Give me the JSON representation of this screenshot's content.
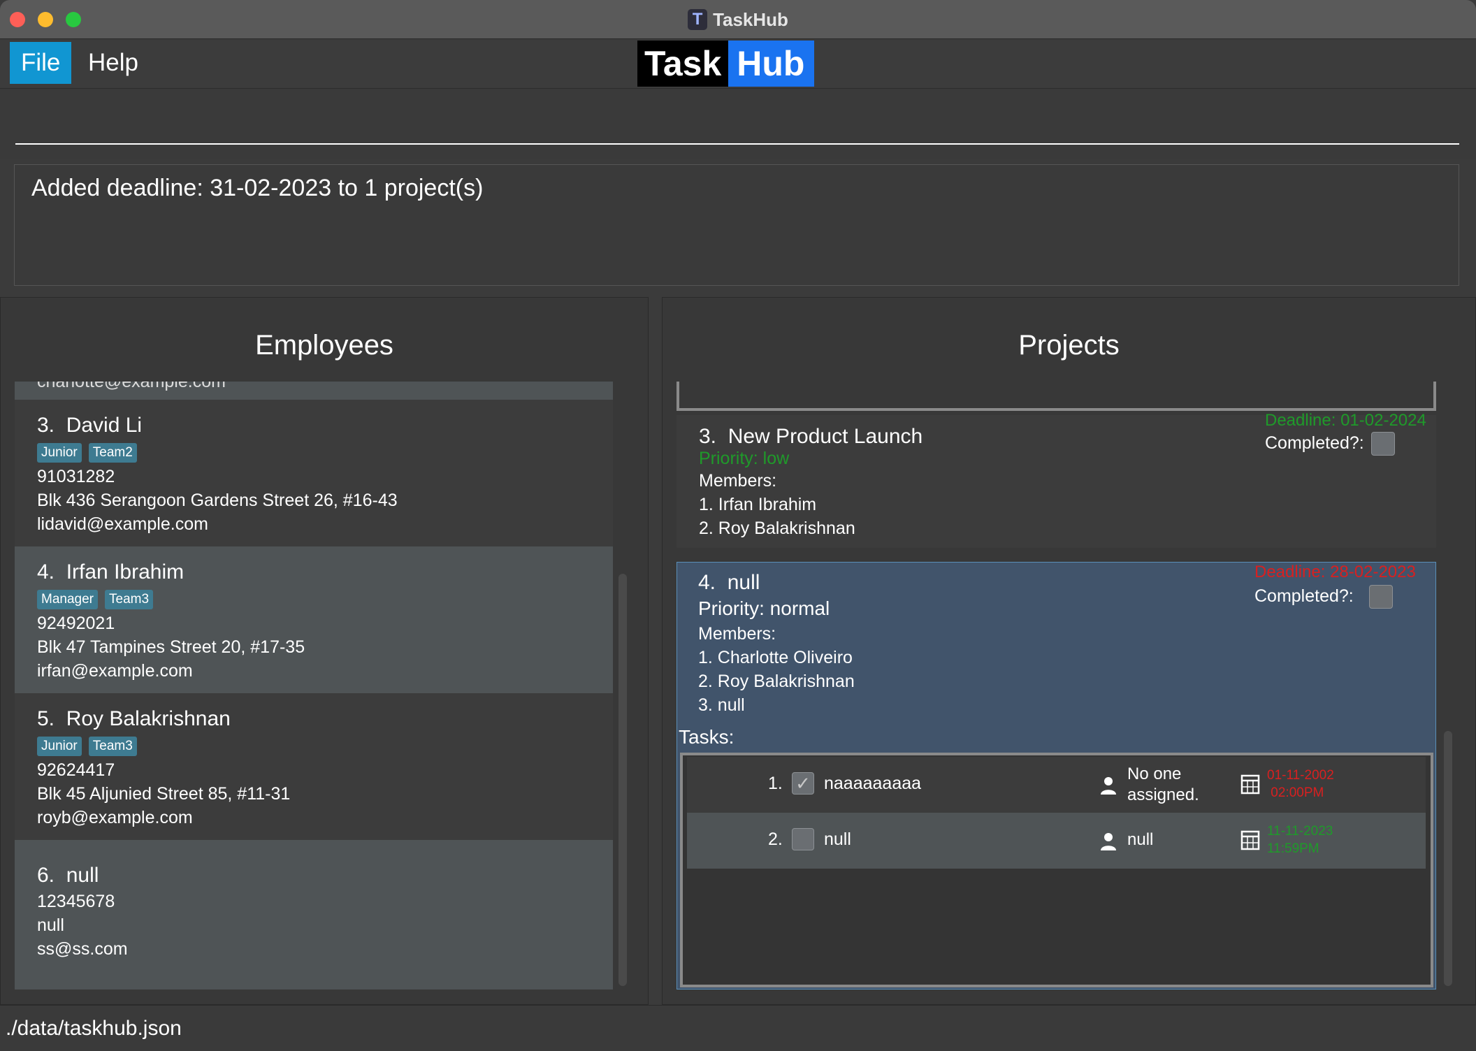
{
  "window": {
    "title": "TaskHub",
    "title_icon_letter": "T"
  },
  "menu": {
    "file_label": "File",
    "help_label": "Help"
  },
  "logo": {
    "part1": "Task",
    "part2": "Hub",
    "part1_bg": "#000000",
    "part2_bg": "#1a73f0"
  },
  "command": {
    "value": "",
    "placeholder": ""
  },
  "result": {
    "text": "Added deadline: 31-02-2023 to 1 project(s)"
  },
  "employees": {
    "title": "Employees",
    "cutoff_email": "charlotte@example.com",
    "items": [
      {
        "index": "3.",
        "name": "David Li",
        "tags": [
          "Junior",
          "Team2"
        ],
        "phone": "91031282",
        "address": "Blk 436 Serangoon Gardens Street 26, #16-43",
        "email": "lidavid@example.com"
      },
      {
        "index": "4.",
        "name": "Irfan Ibrahim",
        "tags": [
          "Manager",
          "Team3"
        ],
        "phone": "92492021",
        "address": "Blk 47 Tampines Street 20, #17-35",
        "email": "irfan@example.com"
      },
      {
        "index": "5.",
        "name": "Roy Balakrishnan",
        "tags": [
          "Junior",
          "Team3"
        ],
        "phone": "92624417",
        "address": "Blk 45 Aljunied Street 85, #11-31",
        "email": "royb@example.com"
      },
      {
        "index": "6.",
        "name": "null",
        "tags": [],
        "phone": "12345678",
        "address": "null",
        "email": "ss@ss.com"
      }
    ]
  },
  "projects": {
    "title": "Projects",
    "items": [
      {
        "index": "3.",
        "name": "New Product Launch",
        "priority": "Priority: low",
        "deadline": "Deadline: 01-02-2024",
        "completed_label": "Completed?:",
        "members_label": "Members:",
        "members": [
          "1. Irfan Ibrahim",
          "2. Roy Balakrishnan"
        ]
      },
      {
        "index": "4.",
        "name": "null",
        "priority": "Priority: normal",
        "deadline": "Deadline: 28-02-2023",
        "completed_label": "Completed?:",
        "members_label": "Members:",
        "members": [
          "1. Charlotte Oliveiro",
          "2. Roy Balakrishnan",
          "3. null"
        ],
        "tasks_label": "Tasks:",
        "tasks": [
          {
            "num": "1.",
            "done": true,
            "desc": "naaaaaaaaa",
            "assignee_line1": "No one",
            "assignee_line2": "assigned.",
            "date": "01-11-2002",
            "time": "02:00PM"
          },
          {
            "num": "2.",
            "done": false,
            "desc": "null",
            "assignee_line1": "null",
            "assignee_line2": "",
            "date": "11-11-2023",
            "time": "11:59PM"
          }
        ]
      }
    ]
  },
  "status": {
    "path": "./data/taskhub.json"
  },
  "colors": {
    "accent": "#1196d2",
    "tag": "#3e7b91",
    "deadline_ok": "#1f9a2a",
    "deadline_overdue": "#d82020",
    "selected_card": "#41546b"
  }
}
